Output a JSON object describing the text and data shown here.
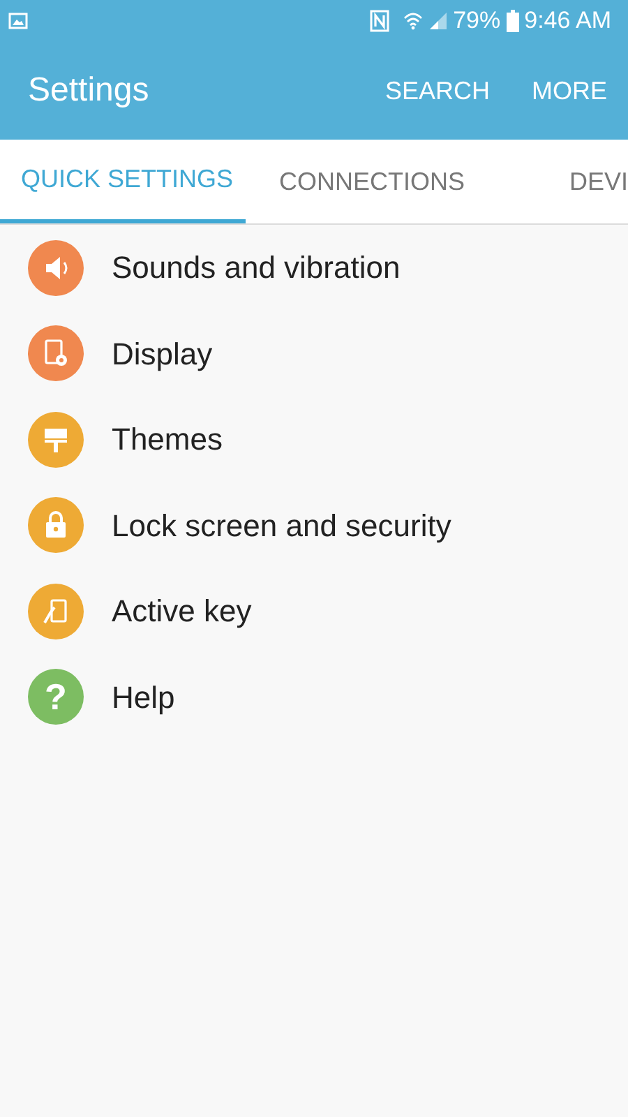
{
  "status_bar": {
    "battery": "79%",
    "time": "9:46 AM"
  },
  "app_bar": {
    "title": "Settings",
    "actions": [
      "SEARCH",
      "MORE"
    ]
  },
  "tabs": [
    {
      "label": "QUICK SETTINGS",
      "selected": true
    },
    {
      "label": "CONNECTIONS",
      "selected": false
    },
    {
      "label": "DEVI",
      "selected": false
    }
  ],
  "items": [
    {
      "label": "Sounds and vibration",
      "kind": "sound",
      "color": "#f0884f"
    },
    {
      "label": "Display",
      "kind": "display",
      "color": "#f0884f"
    },
    {
      "label": "Themes",
      "kind": "themes",
      "color": "#eeaa35"
    },
    {
      "label": "Lock screen and security",
      "kind": "lock",
      "color": "#eeaa35"
    },
    {
      "label": "Active key",
      "kind": "key",
      "color": "#eeaa35"
    },
    {
      "label": "Help",
      "kind": "help",
      "color": "#7dbd62",
      "glyph": "?"
    }
  ]
}
